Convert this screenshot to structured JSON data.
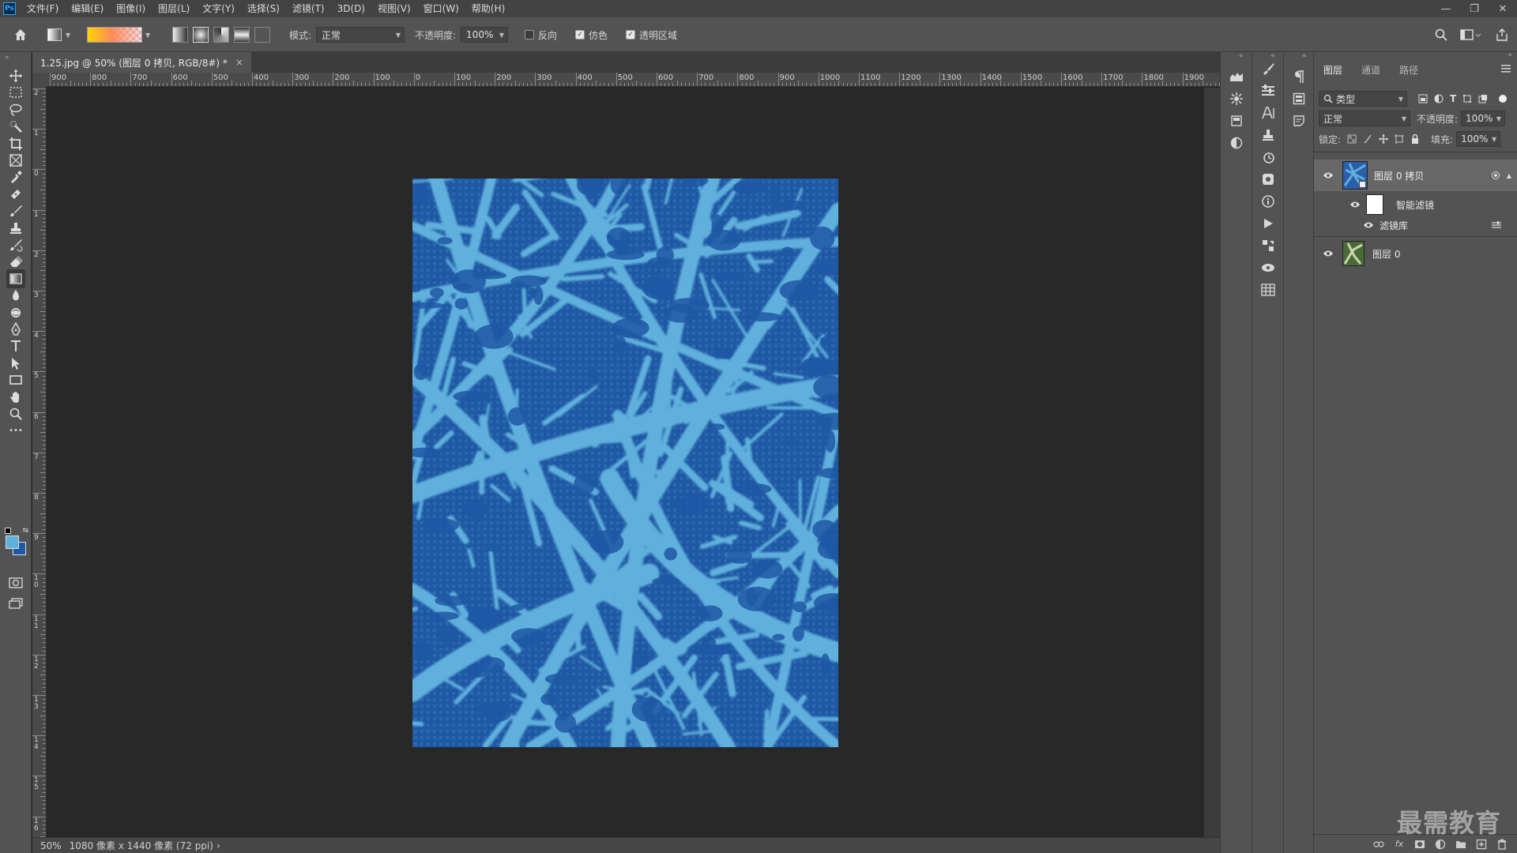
{
  "app": {
    "logo_text": "Ps",
    "menus": [
      "文件(F)",
      "编辑(E)",
      "图像(I)",
      "图层(L)",
      "文字(Y)",
      "选择(S)",
      "滤镜(T)",
      "3D(D)",
      "视图(V)",
      "窗口(W)",
      "帮助(H)"
    ],
    "window_controls": [
      "—",
      "❐",
      "✕"
    ]
  },
  "options": {
    "mode_label": "模式:",
    "mode_value": "正常",
    "opacity_label": "不透明度:",
    "opacity_value": "100%",
    "reverse_label": "反向",
    "reverse_checked": false,
    "dither_label": "仿色",
    "dither_checked": true,
    "transparency_label": "透明区域",
    "transparency_checked": true
  },
  "document": {
    "tab_title": "1.25.jpg @ 50% (图层 0 拷贝, RGB/8#) *",
    "close_glyph": "×",
    "zoom": "50%",
    "doc_info": "1080 像素 x 1440 像素 (72 ppi)",
    "status_arrow": "›",
    "colors": {
      "dark_blue": "#1f58a4",
      "light_blue": "#5fb0dc"
    }
  },
  "rulers": {
    "top_ticks": [
      "900",
      "800",
      "700",
      "600",
      "500",
      "400",
      "300",
      "200",
      "100",
      "0",
      "100",
      "200",
      "300",
      "400",
      "500",
      "600",
      "700",
      "800",
      "900",
      "1000",
      "1100",
      "1200",
      "1300",
      "1400",
      "1500",
      "1600",
      "1700",
      "1800",
      "1900"
    ],
    "left_ticks": [
      "2",
      "1",
      "0",
      "1",
      "2",
      "3",
      "4",
      "5",
      "6",
      "7",
      "8",
      "9",
      "10",
      "11",
      "12",
      "13",
      "14",
      "15",
      "16"
    ]
  },
  "toolbar": {
    "tools": [
      "move-tool",
      "marquee-tool",
      "lasso-tool",
      "quick-select-tool",
      "crop-tool",
      "frame-tool",
      "eyedropper-tool",
      "healing-tool",
      "brush-tool",
      "clone-stamp-tool",
      "history-brush-tool",
      "eraser-tool",
      "gradient-tool",
      "blur-tool",
      "dodge-tool",
      "pen-tool",
      "type-tool",
      "path-select-tool",
      "rectangle-tool",
      "hand-tool",
      "zoom-tool",
      "more-tools"
    ],
    "active_tool": "gradient-tool",
    "foreground_color": "#5fb0dc",
    "background_color": "#1f58a4",
    "type_glyph": "T",
    "more_glyph": "•••"
  },
  "layers_panel": {
    "tabs": [
      "图层",
      "通道",
      "路径"
    ],
    "active_tab": "图层",
    "filter_label": "类型",
    "blend_mode": "正常",
    "opacity_label": "不透明度:",
    "opacity_value": "100%",
    "lock_label": "锁定:",
    "fill_label": "填充:",
    "fill_value": "100%",
    "layers": [
      {
        "name": "图层 0 拷贝",
        "selected": true,
        "smart_filters_label": "智能滤镜",
        "filter_name": "滤镜库"
      },
      {
        "name": "图层 0",
        "selected": false
      }
    ],
    "footer_icons": [
      "link-icon",
      "fx-icon",
      "mask-icon",
      "adjustment-icon",
      "folder-icon",
      "new-layer-icon",
      "trash-icon"
    ],
    "footer_fx_text": "fx"
  },
  "watermark": "最需教育"
}
